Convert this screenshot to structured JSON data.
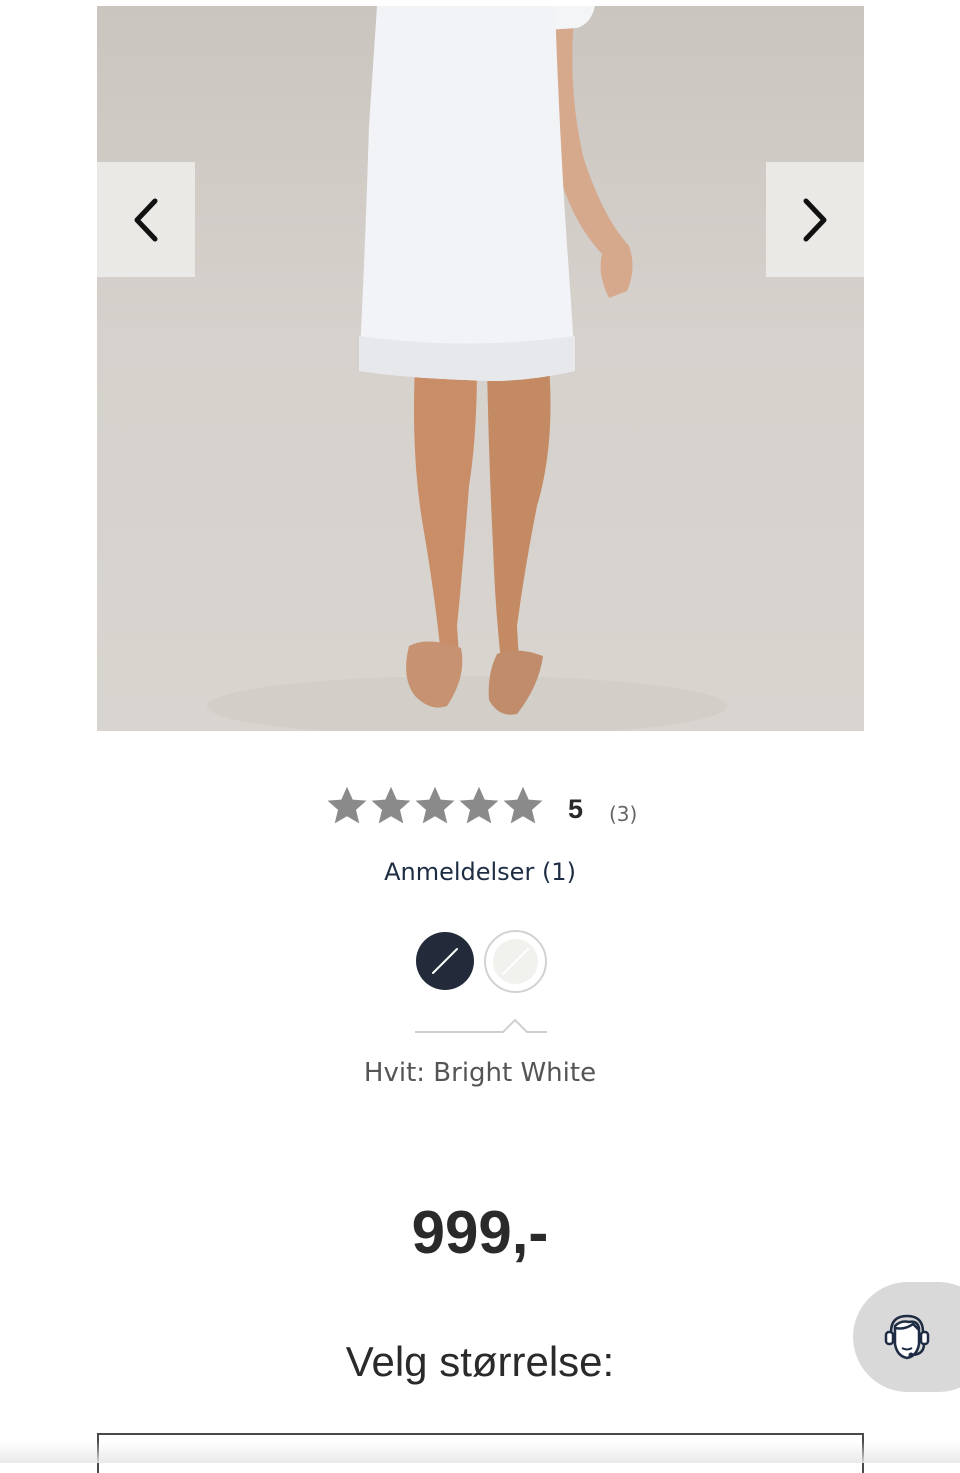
{
  "gallery": {
    "image_alt": "",
    "prev_icon": "chevron-left-icon",
    "next_icon": "chevron-right-icon"
  },
  "rating": {
    "stars": 5,
    "score": "5",
    "count": "(3)"
  },
  "reviews_link": "Anmeldelser (1)",
  "colors": {
    "options": [
      {
        "name": "navy",
        "hex": "#232a3a"
      },
      {
        "name": "white",
        "hex": "#f1f1ee"
      }
    ],
    "selected_label": "Hvit: Bright White"
  },
  "price": "999,-",
  "size": {
    "label": "Velg størrelse:"
  },
  "chat": {
    "icon": "support-agent-icon"
  }
}
